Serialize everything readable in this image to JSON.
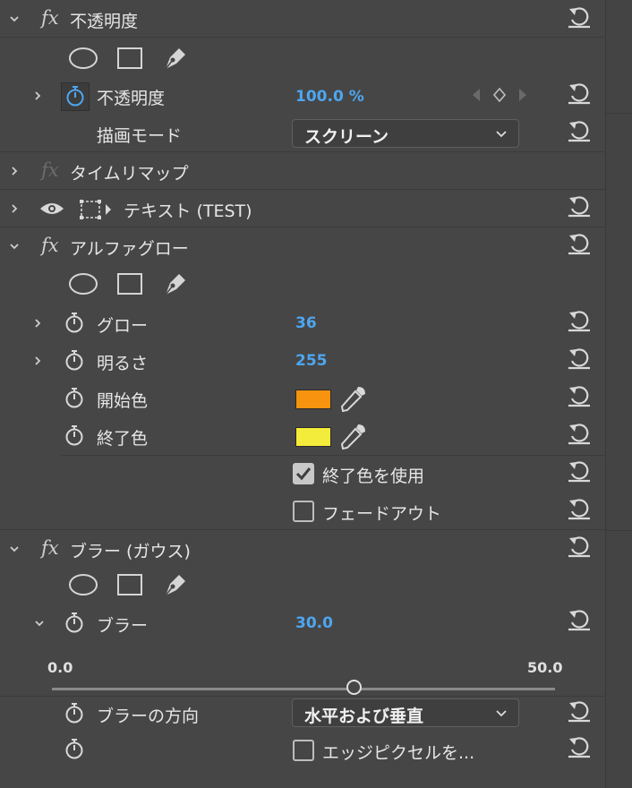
{
  "opacity_section": {
    "title": "不透明度",
    "expanded": true
  },
  "opacity_row": {
    "label": "不透明度",
    "value": "100.0 %"
  },
  "blend_row": {
    "label": "描画モード",
    "dropdown_value": "スクリーン"
  },
  "time_remap": {
    "title": "タイムリマップ"
  },
  "text_layer": {
    "title": "テキスト (TEST)"
  },
  "alpha_glow": {
    "title": "アルファグロー",
    "glow": {
      "label": "グロー",
      "value": "36"
    },
    "brightness": {
      "label": "明るさ",
      "value": "255"
    },
    "start_color": {
      "label": "開始色",
      "color": "#f7930e"
    },
    "end_color": {
      "label": "終了色",
      "color": "#f4ec3a"
    },
    "use_end_color": {
      "label": "終了色を使用",
      "checked": true
    },
    "fade_out": {
      "label": "フェードアウト",
      "checked": false
    }
  },
  "gaussian_blur": {
    "title": "ブラー (ガウス)",
    "blur": {
      "label": "ブラー",
      "value": "30.0"
    },
    "slider": {
      "min": "0.0",
      "max": "50.0",
      "value": 30.0
    },
    "direction": {
      "label": "ブラーの方向",
      "dropdown_value": "水平および垂直"
    },
    "edge_pixels": {
      "label": "エッジピクセルを...",
      "checked": false
    }
  },
  "colors": {
    "accent_value": "#4ea6f0",
    "panel_bg": "#464646"
  }
}
